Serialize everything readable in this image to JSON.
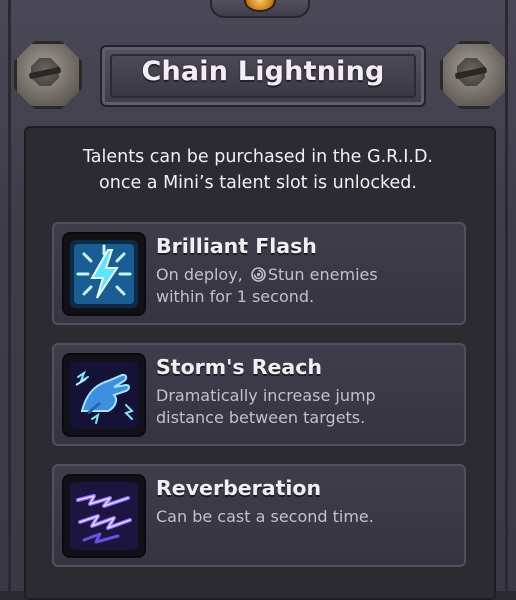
{
  "title": "Chain Lightning",
  "description": {
    "line1": "Talents can be purchased in the G.R.I.D.",
    "line2": "once a Mini’s talent slot is unlocked."
  },
  "talents": [
    {
      "name": "Brilliant Flash",
      "icon": "lightning-flash-icon",
      "line1_prefix": "On deploy, ",
      "line1_keyword": "Stun enemies",
      "line2": "within for 1 second."
    },
    {
      "name": "Storm's Reach",
      "icon": "storm-hand-icon",
      "line1": "Dramatically increase jump",
      "line2": "distance between targets."
    },
    {
      "name": "Reverberation",
      "icon": "reverberation-bolts-icon",
      "line1": "Can be cast a second time."
    }
  ],
  "colors": {
    "text_primary": "#f1eef4",
    "text_secondary": "#c4c0c9",
    "lightning_blue": "#3fd0ff",
    "lightning_purple": "#7b5cff"
  }
}
